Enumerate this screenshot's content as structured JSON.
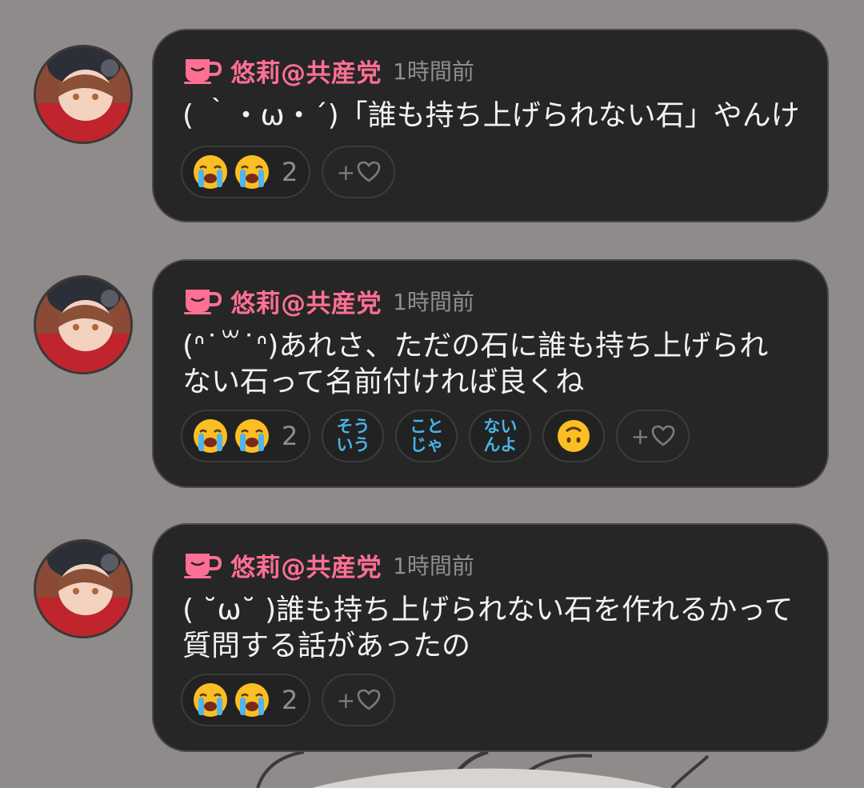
{
  "posts": [
    {
      "username": "悠莉@共産党",
      "time": "1時間前",
      "text": "( ｀・ω・´)「誰も持ち上げられない石」やんけ",
      "reaction_count": "2",
      "extra_reactions": []
    },
    {
      "username": "悠莉@共産党",
      "time": "1時間前",
      "text": "(ᐢ˙꒳˙ᐢ)あれさ、ただの石に誰も持ち上げられ\nない石って名前付ければ良くね",
      "reaction_count": "2",
      "extra_reactions": [
        "そう\nいう",
        "こと\nじゃ",
        "ない\nんよ"
      ]
    },
    {
      "username": "悠莉@共産党",
      "time": "1時間前",
      "text": "( ˘ω˘ )誰も持ち上げられない石を作れるかって\n質問する話があったの",
      "reaction_count": "2",
      "extra_reactions": []
    }
  ],
  "add_reaction_label": "+",
  "colors": {
    "username": "#ff6f93",
    "bubble": "#262626",
    "background": "#8f8b8a",
    "text_emoji": "#46b4e6"
  },
  "icons": {
    "cup": "cup-icon",
    "cry": "loudly-crying-face-icon",
    "upside_down": "upside-down-face-icon",
    "heart": "heart-outline-icon"
  }
}
